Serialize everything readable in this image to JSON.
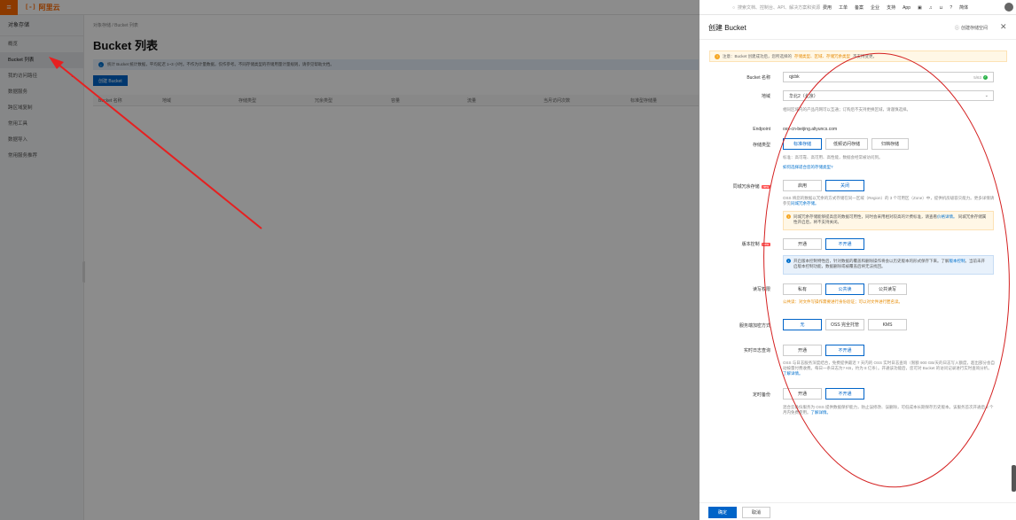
{
  "topbar": {
    "logo": "阿里云",
    "search_placeholder": "搜索文档、控制台、API、解决方案和资源",
    "nav": [
      "费用",
      "工单",
      "备案",
      "企业",
      "支持",
      "App"
    ],
    "lang": "简体"
  },
  "sidebar": {
    "title": "对象存储",
    "items": [
      {
        "label": "概览"
      },
      {
        "label": "Bucket 列表"
      },
      {
        "label": "我的访问路径"
      },
      {
        "label": "数据服务"
      },
      {
        "label": "跨区域复制"
      },
      {
        "label": "常用工具"
      },
      {
        "label": "数据导入"
      },
      {
        "label": "常用服务推荐"
      }
    ]
  },
  "main": {
    "breadcrumb": "对象存储 / Bucket 列表",
    "title": "Bucket 列表",
    "info": "统计 Bucket 统计数据，平均延迟 1~3 小时。不作为计量数据，仅作参考。不同存储类型的存储用量计量规则，请参见帮助文档。",
    "create_button": "创建 Bucket",
    "columns": [
      "Bucket 名称",
      "地域",
      "存储类型",
      "冗余类型",
      "容量",
      "流量",
      "当月访问次数",
      "标准型存储量"
    ]
  },
  "drawer": {
    "title": "创建 Bucket",
    "guide": "创建存储空间",
    "warning": {
      "prefix": "注意：Bucket 创建成功后，您所选择的",
      "highlight": "存储类型、区域、存储冗余类型",
      "suffix": "不支持变更。"
    },
    "bucket_name": {
      "label": "Bucket 名称",
      "value": "qjcbk",
      "count": "5/63"
    },
    "region": {
      "label": "地域",
      "value": "华北2（北京）",
      "help": "相同区域内的产品内网可以互通；订购后不支持更换区域，请谨慎选择。"
    },
    "endpoint": {
      "label": "Endpoint",
      "value": "oss-cn-beijing.aliyuncs.com"
    },
    "storage_class": {
      "label": "存储类型",
      "options": [
        "标准存储",
        "低频访问存储",
        "归档存储"
      ],
      "help": "标准：高可靠、高可用、高性能，数据会经常被访问到。",
      "link": "如何选择适合您的存储类型?"
    },
    "zrs": {
      "label": "同城冗余存储",
      "tag": "new",
      "options": [
        "启用",
        "关闭"
      ],
      "help": "OSS 将您的数据以冗余的方式存储在同一区域（Region）的 3 个可用区（Zone）中，提供机房级容灾能力。更多详情请参见",
      "help_link": "同城冗余存储。",
      "notice": "同城冗余存储能够提高您的数据可用性，同时会采用相对较高的计费标准，请查看",
      "notice_link": "价格详情。",
      "notice_2": "同城冗余存储属性开启后，将不支持关闭。"
    },
    "versioning": {
      "label": "版本控制",
      "tag": "new",
      "options": [
        "开通",
        "不开通"
      ],
      "notice": "开启版本控制特性后，针对数据的覆盖和删除操作将会以历史版本的形式保存下来。了解",
      "notice_link": "版本控制",
      "notice_2": "。当前未开启版本控制功能，数据删除或被覆盖后将无法找回。"
    },
    "acl": {
      "label": "读写权限",
      "options": [
        "私有",
        "公共读",
        "公共读写"
      ],
      "warn": "公共读：对文件写操作需要进行身份验证；可以对文件进行匿名读。"
    },
    "encryption": {
      "label": "服务端加密方式",
      "options": [
        "无",
        "OSS 完全托管",
        "KMS"
      ]
    },
    "log_query": {
      "label": "实时日志查询",
      "options": [
        "开通",
        "不开通"
      ],
      "help": "OSS 与日志服务深度结合，免费提供最近 7 天内的 OSS 实时日志查询（限额 900 GB/天的日志写入额度，超出部分会自动按量付费收费。每日一条日志为? KB，约为 8 亿条）。开通该功能后，您可对 Bucket 的访问记录进行实时查询分析。",
      "help_link": "了解详情。"
    },
    "backup": {
      "label": "定时备份",
      "options": [
        "开通",
        "不开通"
      ],
      "help": "混合云备份服务为 OSS 提供数据保护能力，防止误修改、误删除，可低成本长期保存历史版本。该服务首次开通后 2 个月内免费使用。",
      "help_link": "了解详情。"
    },
    "ok": "确定",
    "cancel": "取消"
  }
}
